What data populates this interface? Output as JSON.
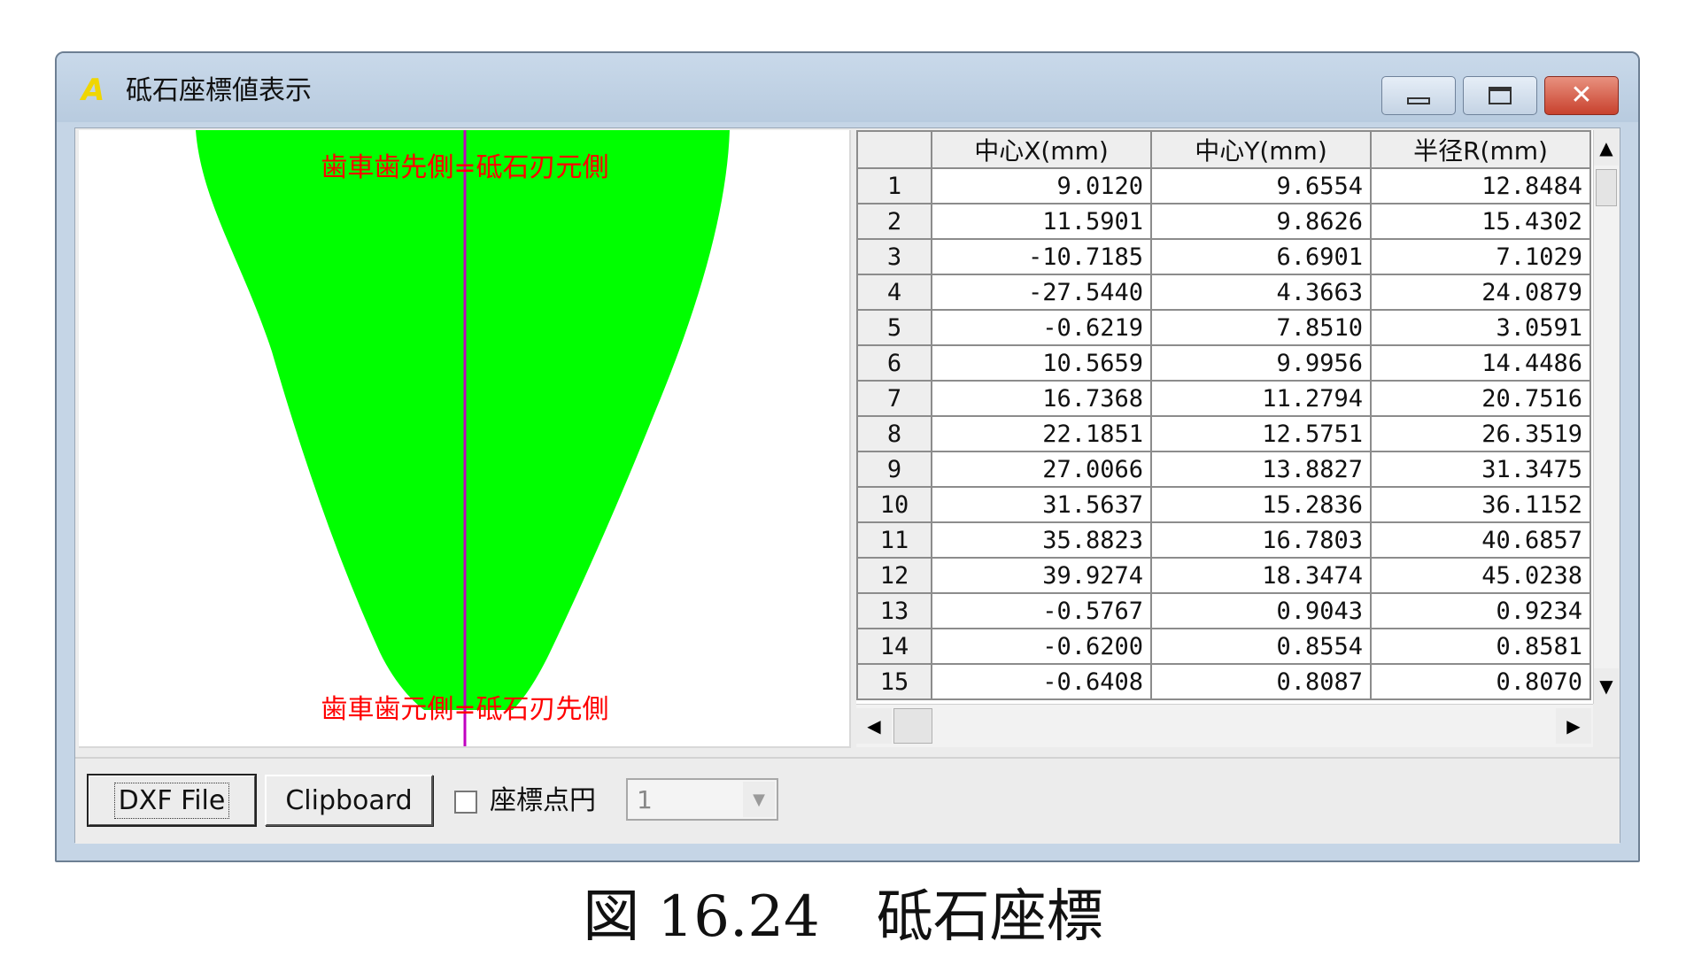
{
  "window": {
    "title": "砥石座標値表示",
    "app_icon_glyph": "A",
    "minimize_glyph": "—",
    "maximize_glyph": "□",
    "close_glyph": "✕"
  },
  "canvas": {
    "top_label": "歯車歯先側=砥石刃元側",
    "bottom_label": "歯車歯元側=砥石刃先側",
    "fill_color": "#00ff00",
    "axis_color": "#c000c0",
    "label_color": "#ff0000"
  },
  "table": {
    "headers": [
      "中心X(mm)",
      "中心Y(mm)",
      "半径R(mm)"
    ],
    "rows": [
      {
        "n": "1",
        "x": "9.0120",
        "y": "9.6554",
        "r": "12.8484"
      },
      {
        "n": "2",
        "x": "11.5901",
        "y": "9.8626",
        "r": "15.4302"
      },
      {
        "n": "3",
        "x": "-10.7185",
        "y": "6.6901",
        "r": "7.1029"
      },
      {
        "n": "4",
        "x": "-27.5440",
        "y": "4.3663",
        "r": "24.0879"
      },
      {
        "n": "5",
        "x": "-0.6219",
        "y": "7.8510",
        "r": "3.0591"
      },
      {
        "n": "6",
        "x": "10.5659",
        "y": "9.9956",
        "r": "14.4486"
      },
      {
        "n": "7",
        "x": "16.7368",
        "y": "11.2794",
        "r": "20.7516"
      },
      {
        "n": "8",
        "x": "22.1851",
        "y": "12.5751",
        "r": "26.3519"
      },
      {
        "n": "9",
        "x": "27.0066",
        "y": "13.8827",
        "r": "31.3475"
      },
      {
        "n": "10",
        "x": "31.5637",
        "y": "15.2836",
        "r": "36.1152"
      },
      {
        "n": "11",
        "x": "35.8823",
        "y": "16.7803",
        "r": "40.6857"
      },
      {
        "n": "12",
        "x": "39.9274",
        "y": "18.3474",
        "r": "45.0238"
      },
      {
        "n": "13",
        "x": "-0.5767",
        "y": "0.9043",
        "r": "0.9234"
      },
      {
        "n": "14",
        "x": "-0.6200",
        "y": "0.8554",
        "r": "0.8581"
      },
      {
        "n": "15",
        "x": "-0.6408",
        "y": "0.8087",
        "r": "0.8070"
      }
    ],
    "scroll_up_glyph": "▲",
    "scroll_down_glyph": "▼",
    "scroll_left_glyph": "◀",
    "scroll_right_glyph": "▶"
  },
  "toolbar": {
    "dxf_label": "DXF File",
    "clipboard_label": "Clipboard",
    "checkbox_label": "座標点円",
    "combo_value": "1",
    "combo_arrow_glyph": "▼"
  },
  "caption": "図 16.24　砥石座標"
}
